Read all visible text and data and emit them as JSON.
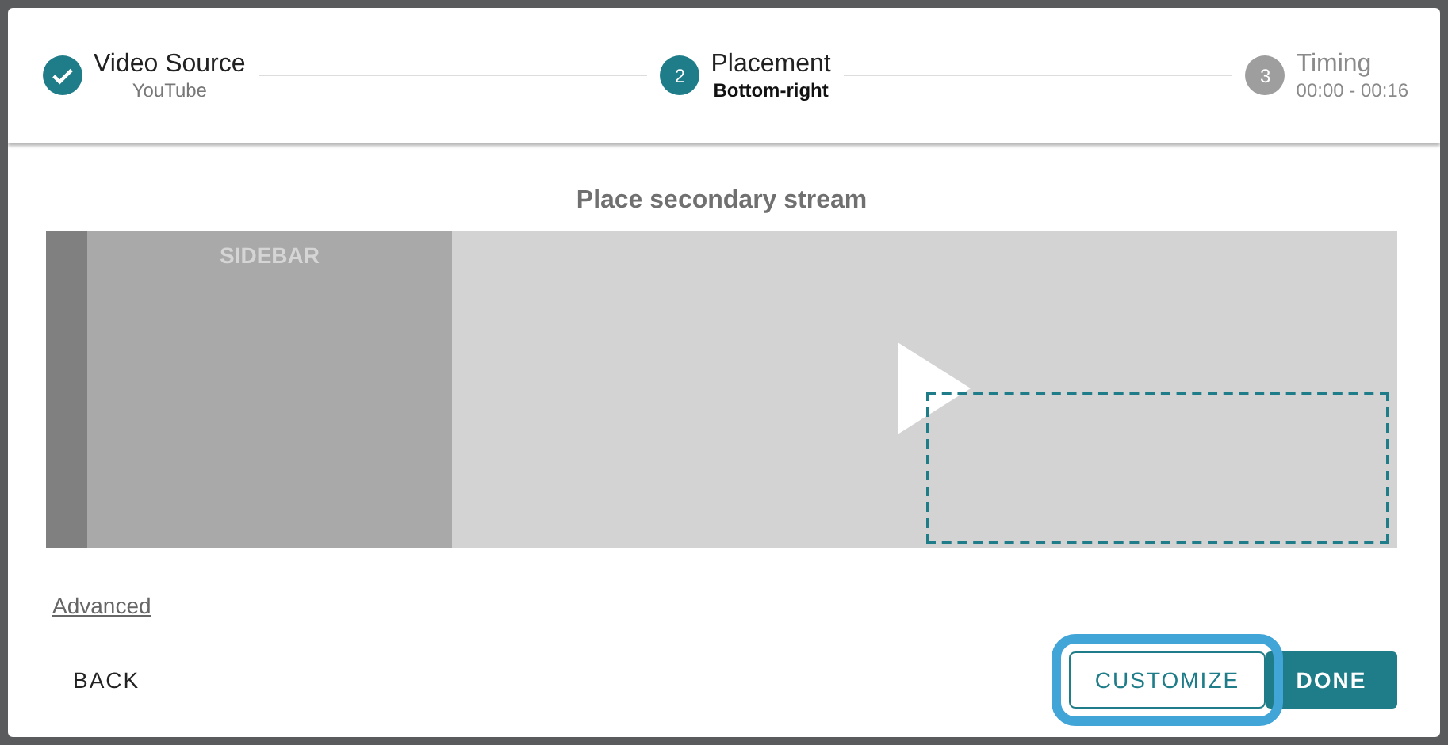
{
  "stepper": [
    {
      "title": "Video Source",
      "subtitle": "YouTube",
      "completed": true,
      "selected": false
    },
    {
      "title": "Placement",
      "subtitle": "Bottom-right",
      "number": "2",
      "completed": false,
      "selected": true
    },
    {
      "title": "Timing",
      "subtitle": "00:00 - 00:16",
      "number": "3",
      "completed": false,
      "selected": false
    }
  ],
  "heading": "Place secondary stream",
  "preview": {
    "sidebar_label": "SIDEBAR",
    "zone": {
      "bottom": true,
      "right": true
    }
  },
  "advanced_link": "Advanced",
  "buttons": [
    {
      "label": "BACK",
      "kind": "text",
      "focused": false
    },
    {
      "label": "CUSTOMIZE",
      "kind": "outline",
      "focused": true
    },
    {
      "label": "DONE",
      "kind": "primary",
      "focused": false
    }
  ]
}
